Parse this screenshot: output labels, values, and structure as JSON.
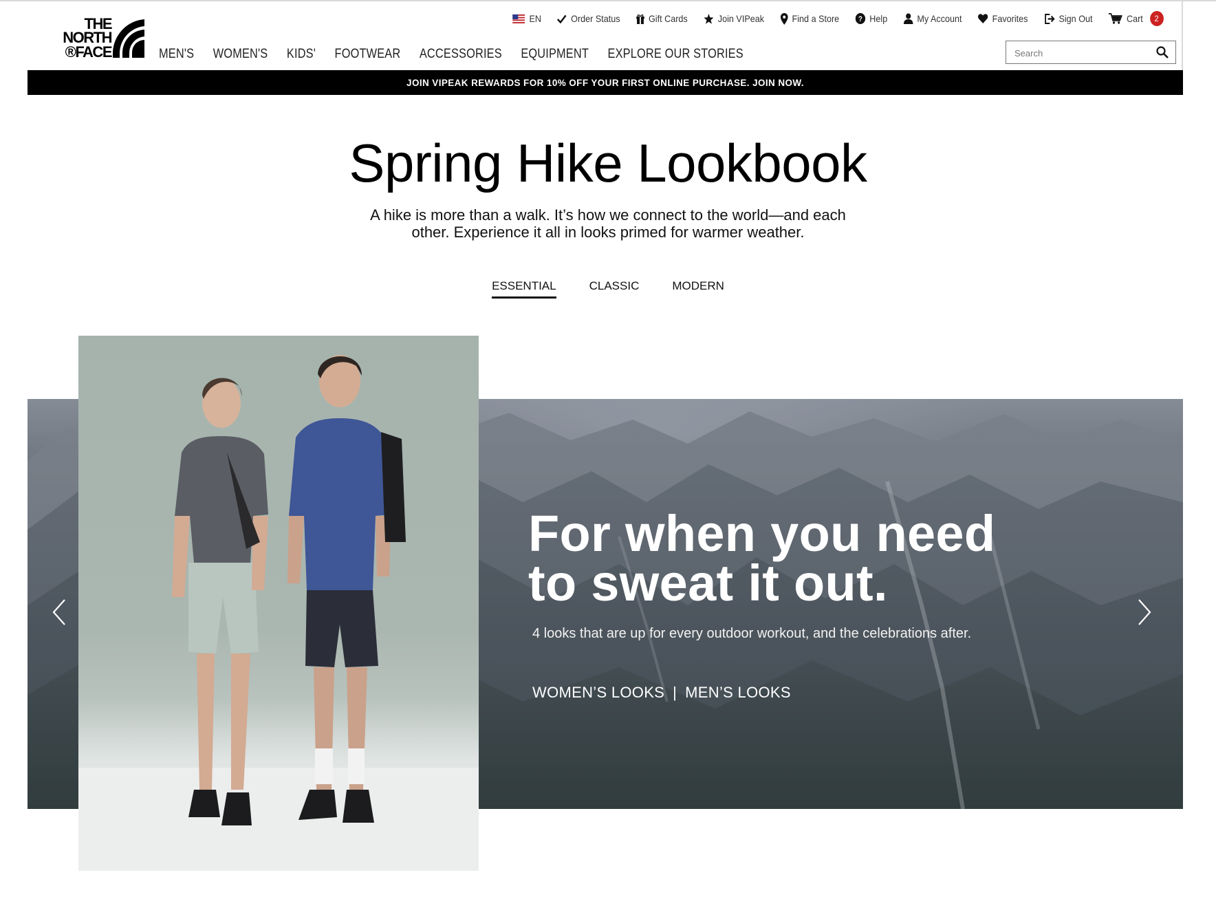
{
  "brand": {
    "logo_lines": [
      "THE",
      "NORTH",
      "®FACE"
    ]
  },
  "utility_nav": [
    {
      "icon": "us-flag-icon",
      "label": "EN"
    },
    {
      "icon": "checkmark-icon",
      "label": "Order Status"
    },
    {
      "icon": "gift-icon",
      "label": "Gift Cards"
    },
    {
      "icon": "star-icon",
      "label": "Join VIPeak"
    },
    {
      "icon": "map-pin-icon",
      "label": "Find a Store"
    },
    {
      "icon": "help-icon",
      "label": "Help"
    },
    {
      "icon": "user-icon",
      "label": "My Account"
    },
    {
      "icon": "heart-icon",
      "label": "Favorites"
    },
    {
      "icon": "sign-out-icon",
      "label": "Sign Out"
    },
    {
      "icon": "cart-icon",
      "label": "Cart",
      "count": "2"
    }
  ],
  "main_nav": [
    "MEN'S",
    "WOMEN'S",
    "KIDS'",
    "FOOTWEAR",
    "ACCESSORIES",
    "EQUIPMENT",
    "EXPLORE OUR STORIES"
  ],
  "search": {
    "placeholder": "Search",
    "value": ""
  },
  "promo": {
    "text": "JOIN VIPEAK REWARDS FOR 10% OFF YOUR FIRST ONLINE PURCHASE. JOIN NOW."
  },
  "page": {
    "title": "Spring Hike Lookbook",
    "intro_line1": "A hike is more than a walk. It’s how we connect to the world—and each",
    "intro_line2": "other. Experience it all in looks primed for warmer weather."
  },
  "tabs": [
    {
      "label": "ESSENTIAL",
      "active": true
    },
    {
      "label": "CLASSIC",
      "active": false
    },
    {
      "label": "MODERN",
      "active": false
    }
  ],
  "hero": {
    "heading_line1": "For when you need",
    "heading_line2": "to sweat it out.",
    "subtext": "4 looks that are up for every outdoor workout, and the celebrations after.",
    "link_women": "WOMEN’S LOOKS",
    "separator": "|",
    "link_men": "MEN’S LOOKS"
  },
  "colors": {
    "promo_bg": "#000000",
    "cart_badge": "#cc2222",
    "text": "#111111"
  }
}
